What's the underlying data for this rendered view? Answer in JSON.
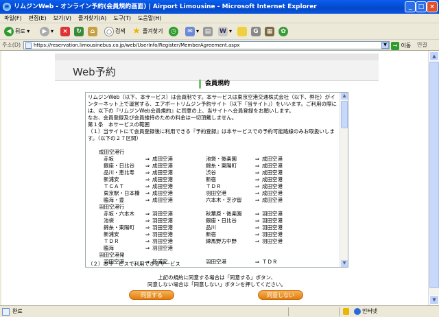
{
  "window": {
    "title": "リムジンWeb - オンライン予約(会員規約画面) | Airport Limousine - Microsoft Internet Explorer",
    "minimize": "_",
    "maximize": "□",
    "close": "×"
  },
  "menu": [
    "파일(F)",
    "편집(E)",
    "보기(V)",
    "즐겨찾기(A)",
    "도구(T)",
    "도움말(H)"
  ],
  "toolbar": {
    "back": "뒤로",
    "search": "검색",
    "favorites": "즐겨찾기"
  },
  "address": {
    "label": "주소(D)",
    "url": "https://reservation.limousinebus.co.jp/web/UserInfo/Register/MemberAgreement.aspx",
    "go": "이동",
    "links": "연결"
  },
  "page": {
    "header": "Web予約",
    "section_title": "会員規約",
    "agreement_intro": "リムジンWeb（以下、本サービス）は会員制です。本サービスは東京空港交通株式会社（以下、弊社）がインターネット上で運営する、エアポートリムジン予約サイト（以下『当サイト』）をいいます。ご利用の際には、以下の『リムジンWeb会員規約』に同意の上、当サイトへ会員登録をお願いします。\nなお、会員登録及び会員維持のための料金は一切頂戴しません。\n第１条　本サービスの範囲\n（１）当サイトにて会員登録後に利用できる『予約登録』は本サービスでの予約可能路線のみお取扱いします。（以下の２７区間）",
    "routes": [
      {
        "category": "成田空港行"
      },
      {
        "c1": "赤坂",
        "c2": "⇒",
        "c3": "成田空港",
        "c4": "池袋・後楽園",
        "c5": "⇒",
        "c6": "成田空港"
      },
      {
        "c1": "銀座・日比谷",
        "c2": "⇒",
        "c3": "成田空港",
        "c4": "錦糸・東陽町",
        "c5": "⇒",
        "c6": "成田空港"
      },
      {
        "c1": "品川・恵比寿",
        "c2": "⇒",
        "c3": "成田空港",
        "c4": "渋谷",
        "c5": "⇒",
        "c6": "成田空港"
      },
      {
        "c1": "新浦安",
        "c2": "⇒",
        "c3": "成田空港",
        "c4": "新宿",
        "c5": "⇒",
        "c6": "成田空港"
      },
      {
        "c1": "ＴＣＡＴ",
        "c2": "⇒",
        "c3": "成田空港",
        "c4": "ＴＤＲ",
        "c5": "⇒",
        "c6": "成田空港"
      },
      {
        "c1": "東京駅・日本橋",
        "c2": "⇒",
        "c3": "成田空港",
        "c4": "羽田空港",
        "c5": "⇒",
        "c6": "成田空港"
      },
      {
        "c1": "臨海・豊",
        "c2": "⇒",
        "c3": "成田空港",
        "c4": "六本木・芝汐留",
        "c5": "⇒",
        "c6": "成田空港"
      },
      {
        "category": "羽田空港行"
      },
      {
        "c1": "赤坂・六本木",
        "c2": "⇒",
        "c3": "羽田空港",
        "c4": "秋葉原・後楽園",
        "c5": "⇒",
        "c6": "羽田空港"
      },
      {
        "c1": "池袋",
        "c2": "⇒",
        "c3": "羽田空港",
        "c4": "銀座・日比谷",
        "c5": "⇒",
        "c6": "羽田空港"
      },
      {
        "c1": "錦糸・東陽町",
        "c2": "⇒",
        "c3": "羽田空港",
        "c4": "品川",
        "c5": "⇒",
        "c6": "羽田空港"
      },
      {
        "c1": "新浦安",
        "c2": "⇒",
        "c3": "羽田空港",
        "c4": "新宿",
        "c5": "⇒",
        "c6": "羽田空港"
      },
      {
        "c1": "ＴＤＲ",
        "c2": "⇒",
        "c3": "羽田空港",
        "c4": "練馬野方中野",
        "c5": "⇒",
        "c6": "羽田空港"
      },
      {
        "c1": "臨海",
        "c2": "⇒",
        "c3": "羽田空港",
        "c4": "",
        "c5": "",
        "c6": ""
      },
      {
        "category": "羽田空港発"
      },
      {
        "c1": "羽田空港",
        "c2": "⇒",
        "c3": "新浦安",
        "c4": "羽田空港",
        "c5": "⇒",
        "c6": "ＴＤＲ"
      }
    ],
    "agreement_tail": "（２）本サービスで利用できるサービス",
    "instructions": "上記の規約に同意する場合は「同意する」ボタン、\n同意しない場合は「同意しない」ボタンを押してください。",
    "agree_button": "同意する",
    "disagree_button": "同意しない"
  },
  "status": {
    "text": "완료",
    "zone": "인터넷"
  }
}
